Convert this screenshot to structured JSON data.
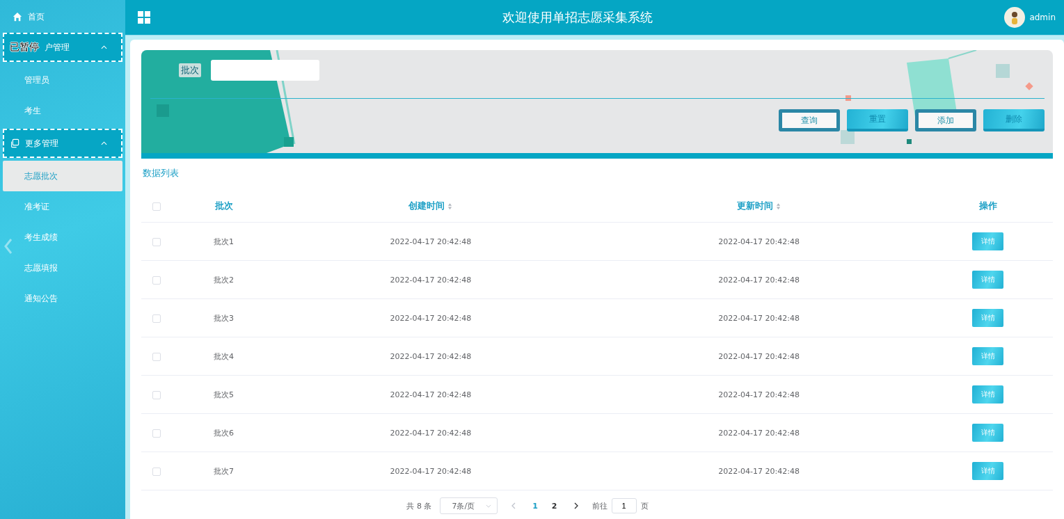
{
  "sidebar": {
    "items": [
      {
        "kind": "link",
        "label": "首页",
        "selected": false
      },
      {
        "kind": "group",
        "label": "户管理",
        "overlay": "已暂停",
        "expanded": true,
        "children": [
          {
            "label": "管理员",
            "selected": false
          },
          {
            "label": "考生",
            "selected": false
          }
        ]
      },
      {
        "kind": "group",
        "label": "更多管理",
        "expanded": true,
        "children": [
          {
            "label": "志愿批次",
            "selected": true
          },
          {
            "label": "准考证",
            "selected": false
          },
          {
            "label": "考生成绩",
            "selected": false
          },
          {
            "label": "志愿填报",
            "selected": false
          },
          {
            "label": "通知公告",
            "selected": false
          }
        ]
      }
    ]
  },
  "header": {
    "title": "欢迎使用单招志愿采集系统",
    "user": "admin"
  },
  "search": {
    "label": "批次"
  },
  "buttons": [
    {
      "label": "查询",
      "kind": "outline"
    },
    {
      "label": "重置",
      "kind": "filled"
    },
    {
      "label": "添加",
      "kind": "outline"
    },
    {
      "label": "删除",
      "kind": "filled"
    }
  ],
  "list_title": "数据列表",
  "table": {
    "columns": [
      {
        "label": "批次",
        "sortable": false
      },
      {
        "label": "创建时间",
        "sortable": true
      },
      {
        "label": "更新时间",
        "sortable": true
      },
      {
        "label": "操作",
        "sortable": false
      }
    ],
    "header_checked": false,
    "rows": [
      {
        "cells": [
          "批次1",
          "2022-04-17 20:42:48",
          "2022-04-17 20:42:48"
        ],
        "checked": false,
        "action": "详情"
      },
      {
        "cells": [
          "批次2",
          "2022-04-17 20:42:48",
          "2022-04-17 20:42:48"
        ],
        "checked": false,
        "action": "详情"
      },
      {
        "cells": [
          "批次3",
          "2022-04-17 20:42:48",
          "2022-04-17 20:42:48"
        ],
        "checked": false,
        "action": "详情"
      },
      {
        "cells": [
          "批次4",
          "2022-04-17 20:42:48",
          "2022-04-17 20:42:48"
        ],
        "checked": false,
        "action": "详情"
      },
      {
        "cells": [
          "批次5",
          "2022-04-17 20:42:48",
          "2022-04-17 20:42:48"
        ],
        "checked": false,
        "action": "详情"
      },
      {
        "cells": [
          "批次6",
          "2022-04-17 20:42:48",
          "2022-04-17 20:42:48"
        ],
        "checked": false,
        "action": "详情"
      },
      {
        "cells": [
          "批次7",
          "2022-04-17 20:42:48",
          "2022-04-17 20:42:48"
        ],
        "checked": false,
        "action": "详情"
      }
    ]
  },
  "pagination": {
    "total": "共 8 条",
    "page_size": "7条/页",
    "pages": [
      {
        "label": "1",
        "selected": true
      },
      {
        "label": "2",
        "selected": false
      }
    ],
    "goto_label": "前往",
    "goto_value": "1",
    "goto_suffix": "页"
  }
}
